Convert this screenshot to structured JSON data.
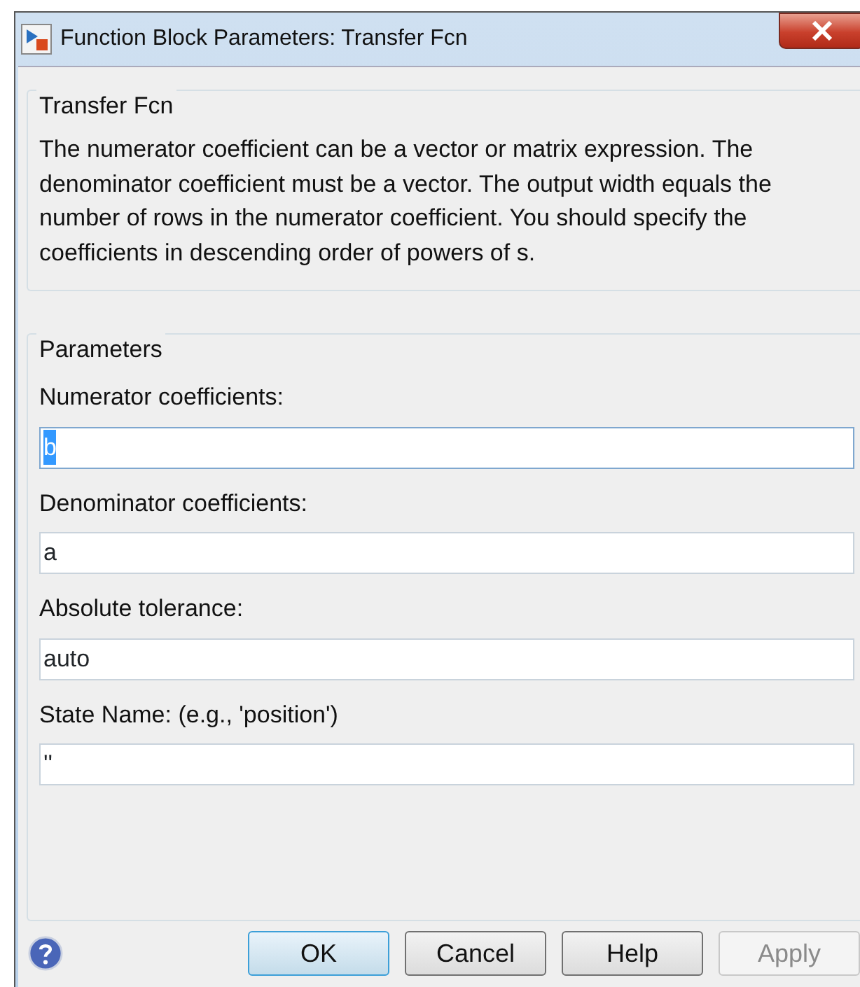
{
  "window": {
    "title": "Function Block Parameters: Transfer Fcn"
  },
  "block_group": {
    "title": "Transfer Fcn",
    "description": "The numerator coefficient can be a vector or matrix expression. The denominator coefficient must be a vector. The output width equals the number of rows in the numerator coefficient. You should specify the coefficients in descending order of powers of s."
  },
  "parameters_group": {
    "title": "Parameters",
    "fields": [
      {
        "label": "Numerator coefficients:",
        "value": "b",
        "text_selected": true
      },
      {
        "label": "Denominator coefficients:",
        "value": "a",
        "text_selected": false
      },
      {
        "label": "Absolute tolerance:",
        "value": "auto",
        "text_selected": false
      },
      {
        "label": "State Name: (e.g., 'position')",
        "value": "''",
        "text_selected": false
      }
    ]
  },
  "buttons": [
    {
      "label": "OK",
      "default": true,
      "disabled": false
    },
    {
      "label": "Cancel",
      "default": false,
      "disabled": false
    },
    {
      "label": "Help",
      "default": false,
      "disabled": false
    },
    {
      "label": "Apply",
      "default": false,
      "disabled": true
    }
  ]
}
